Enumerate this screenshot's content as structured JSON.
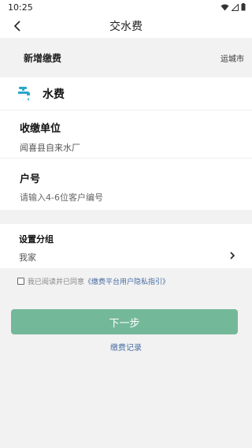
{
  "status_bar": {
    "time": "10:25"
  },
  "nav": {
    "title": "交水费"
  },
  "sub_header": {
    "title": "新增缴费",
    "city": "运城市"
  },
  "bill_type": {
    "label": "水费",
    "icon": "water-tap-icon"
  },
  "unit": {
    "label": "收缴单位",
    "value": "闻喜县自来水厂"
  },
  "account": {
    "label": "户号",
    "placeholder": "请输入4-6位客户编号"
  },
  "group": {
    "label": "设置分组",
    "value": "我家"
  },
  "agreement": {
    "prefix": "我已阅读并已同意",
    "link": "《缴费平台用户隐私指引》",
    "checked": false
  },
  "actions": {
    "next_label": "下一步",
    "record_label": "缴费记录"
  },
  "colors": {
    "primary": "#74b89a",
    "link": "#4a6fa5",
    "tap_icon": "#2aa7c9"
  }
}
